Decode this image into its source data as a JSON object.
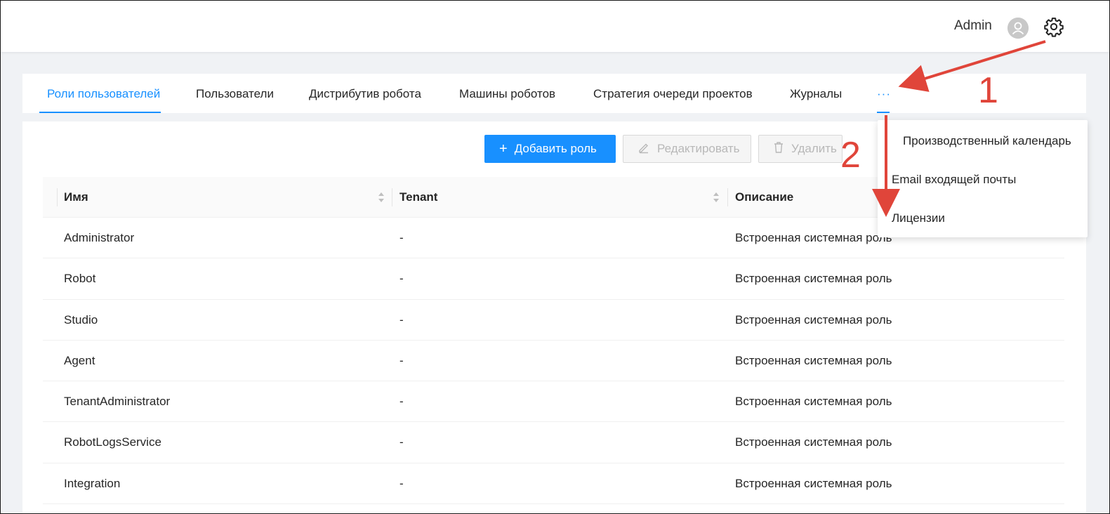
{
  "header": {
    "user_name": "Admin",
    "avatar_icon": "user-avatar-icon",
    "settings_icon": "gear-icon"
  },
  "tabs": [
    {
      "label": "Роли пользователей",
      "active": true
    },
    {
      "label": "Пользователи",
      "active": false
    },
    {
      "label": "Дистрибутив робота",
      "active": false
    },
    {
      "label": "Машины роботов",
      "active": false
    },
    {
      "label": "Стратегия очереди проектов",
      "active": false
    },
    {
      "label": "Журналы",
      "active": false
    },
    {
      "label": "···",
      "active": false
    }
  ],
  "toolbar": {
    "add_label": "Добавить роль",
    "add_icon": "plus-icon",
    "edit_label": "Редактировать",
    "edit_icon": "pencil-icon",
    "delete_label": "Удалить",
    "delete_icon": "trash-icon"
  },
  "table": {
    "columns": [
      "Имя",
      "Tenant",
      "Описание"
    ],
    "rows": [
      {
        "name": "Administrator",
        "tenant": "-",
        "description": "Встроенная системная роль"
      },
      {
        "name": "Robot",
        "tenant": "-",
        "description": "Встроенная системная роль"
      },
      {
        "name": "Studio",
        "tenant": "-",
        "description": "Встроенная системная роль"
      },
      {
        "name": "Agent",
        "tenant": "-",
        "description": "Встроенная системная роль"
      },
      {
        "name": "TenantAdministrator",
        "tenant": "-",
        "description": "Встроенная системная роль"
      },
      {
        "name": "RobotLogsService",
        "tenant": "-",
        "description": "Встроенная системная роль"
      },
      {
        "name": "Integration",
        "tenant": "-",
        "description": "Встроенная системная роль"
      }
    ]
  },
  "dropdown": {
    "items": [
      "Производственный календарь",
      "Email входящей почты",
      "Лицензии"
    ]
  },
  "annotations": {
    "step1": "1",
    "step2": "2",
    "color": "#e0453a"
  },
  "colors": {
    "accent": "#1890ff"
  }
}
